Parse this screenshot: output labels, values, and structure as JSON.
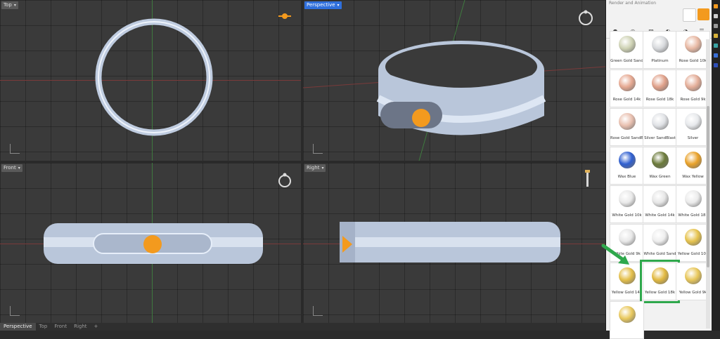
{
  "viewports": {
    "top": {
      "label": "Top"
    },
    "perspective": {
      "label": "Perspective"
    },
    "front": {
      "label": "Front"
    },
    "right": {
      "label": "Right"
    }
  },
  "bottom_tabs": [
    "Perspective",
    "Top",
    "Front",
    "Right",
    "+"
  ],
  "panel": {
    "title": "Render and Animation",
    "materials": [
      {
        "label": "Green Gold Sand",
        "color": "#cfd3b5"
      },
      {
        "label": "Platinum",
        "color": "#d8dadd"
      },
      {
        "label": "Rose Gold 10k",
        "color": "#e8b9a4"
      },
      {
        "label": "Rose Gold 14k",
        "color": "#e6a992"
      },
      {
        "label": "Rose Gold 18k",
        "color": "#e0a18a"
      },
      {
        "label": "Rose Gold 9k",
        "color": "#e4ae99"
      },
      {
        "label": "Rose Gold SandB",
        "color": "#e9c0b0"
      },
      {
        "label": "Silver SandBlast",
        "color": "#e0e2e6"
      },
      {
        "label": "Silver",
        "color": "#e7e9ec"
      },
      {
        "label": "Wax Blue",
        "color": "#2f5fd0"
      },
      {
        "label": "Wax Green",
        "color": "#6b7a3a"
      },
      {
        "label": "Wax Yellow",
        "color": "#e9a22a"
      },
      {
        "label": "White Gold 10k",
        "color": "#e9e9e9"
      },
      {
        "label": "White Gold 14k",
        "color": "#e6e6e6"
      },
      {
        "label": "White Gold 18k",
        "color": "#ebebeb"
      },
      {
        "label": "White Gold 9k",
        "color": "#e8e8e8"
      },
      {
        "label": "White Gold Sand",
        "color": "#eeeeee"
      },
      {
        "label": "Yellow Gold 10k",
        "color": "#e6c34e"
      },
      {
        "label": "Yellow Gold 14k",
        "color": "#e4bf4a"
      },
      {
        "label": "Yellow Gold 18k",
        "color": "#e2b940"
      },
      {
        "label": "Yellow Gold 9k",
        "color": "#e8c75a"
      },
      {
        "label": "",
        "color": "#e9c95e"
      }
    ],
    "selected": "Yellow Gold 18k"
  },
  "colors": {
    "accent_orange": "#f39a1e",
    "selection_green": "#2fa84c",
    "active_label": "#2f6fdc"
  }
}
